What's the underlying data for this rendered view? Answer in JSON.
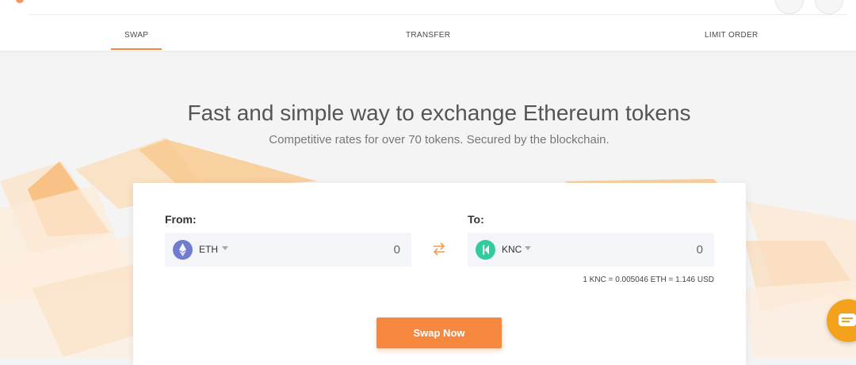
{
  "nav": {
    "tabs": [
      {
        "label": "SWAP",
        "active": true
      },
      {
        "label": "TRANSFER",
        "active": false
      },
      {
        "label": "LIMIT ORDER",
        "active": false
      }
    ]
  },
  "hero": {
    "title": "Fast and simple way to exchange Ethereum tokens",
    "subtitle": "Competitive rates for over 70 tokens. Secured by the blockchain."
  },
  "swap": {
    "from": {
      "label": "From:",
      "token": "ETH",
      "amount": "0",
      "icon": "ethereum-icon"
    },
    "to": {
      "label": "To:",
      "token": "KNC",
      "amount": "0",
      "icon": "kyber-icon"
    },
    "rate": "1 KNC = 0.005046 ETH = 1.146 USD",
    "button": "Swap Now"
  },
  "colors": {
    "accent": "#f6873f",
    "eth": "#6f7ccf",
    "knc": "#31cb9e",
    "chat": "#f4a21c"
  }
}
